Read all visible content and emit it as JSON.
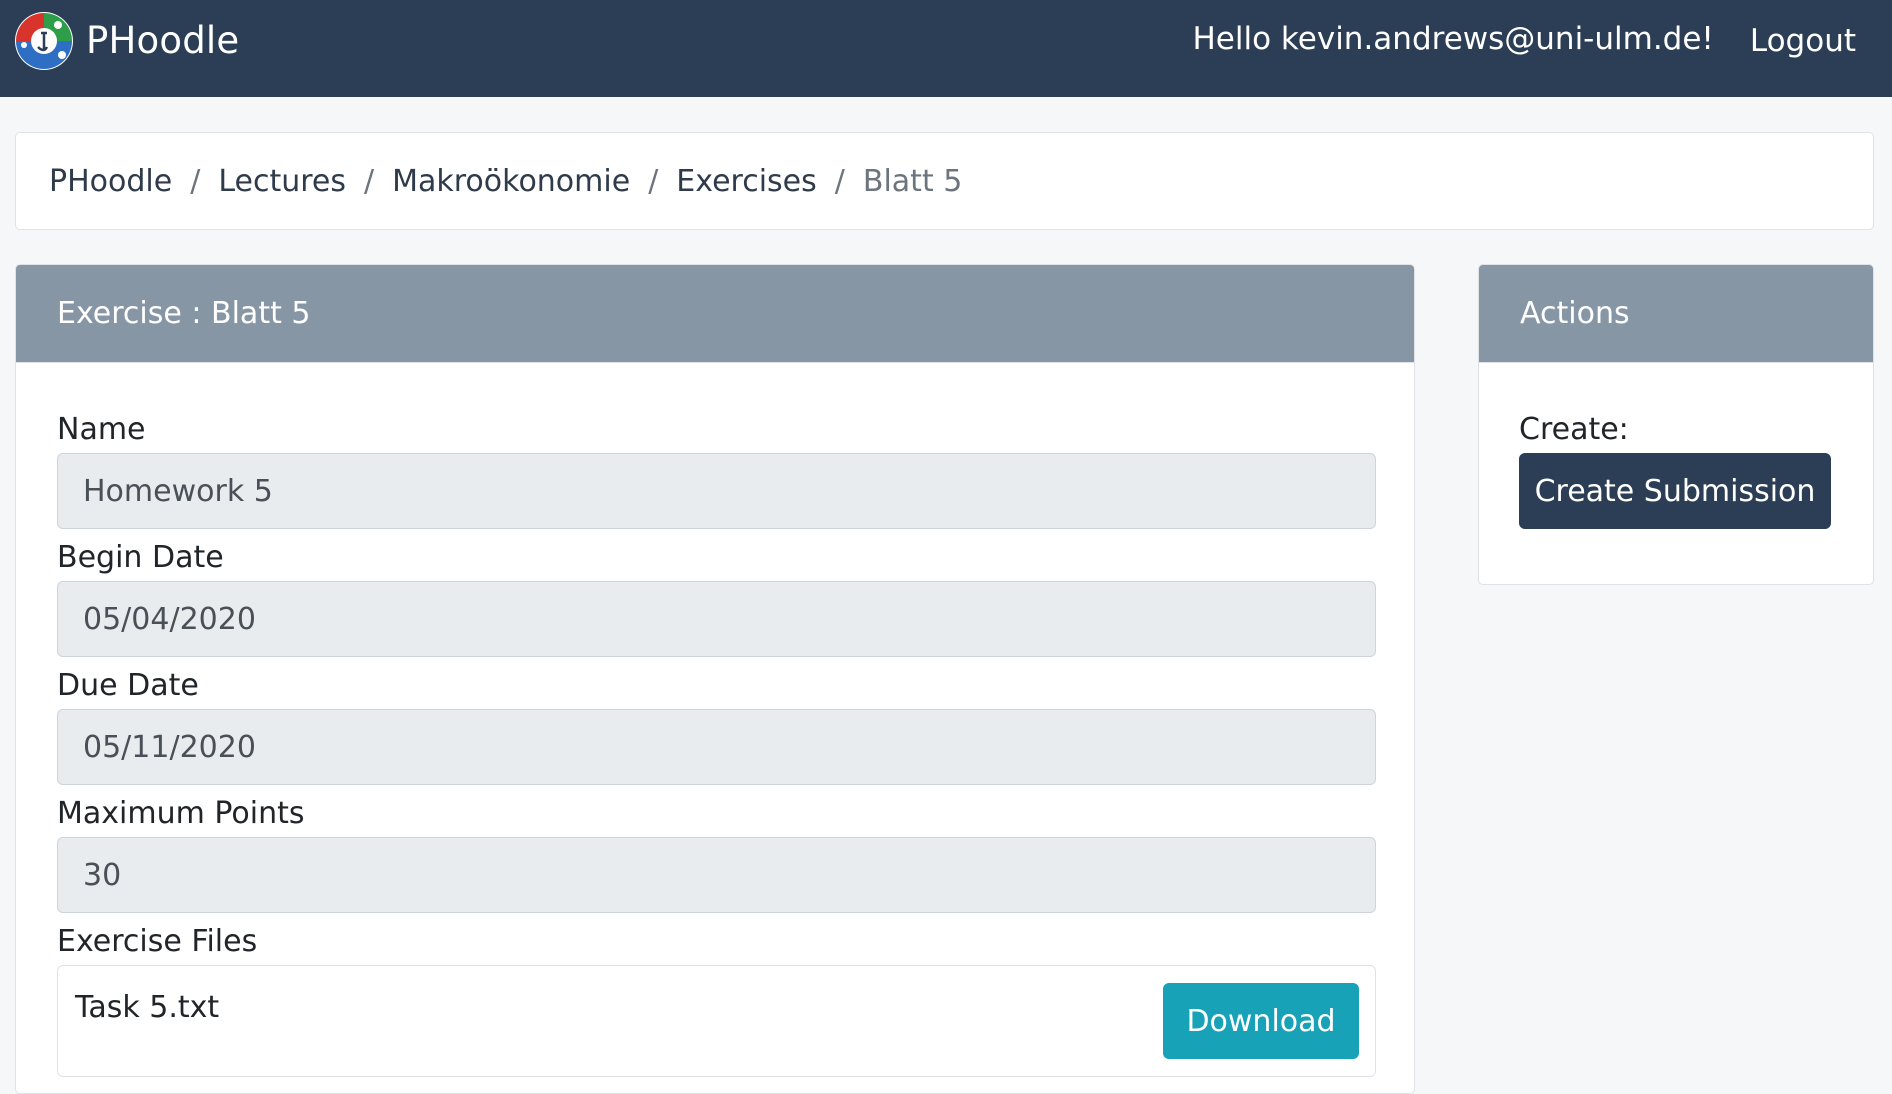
{
  "header": {
    "brand": "PHoodle",
    "greeting": "Hello kevin.andrews@uni-ulm.de!",
    "logout_label": "Logout"
  },
  "breadcrumb": {
    "items": [
      "PHoodle",
      "Lectures",
      "Makroökonomie",
      "Exercises",
      "Blatt 5"
    ],
    "separator": "/"
  },
  "exercise": {
    "header": "Exercise : Blatt 5",
    "name_label": "Name",
    "name_value": "Homework 5",
    "begin_label": "Begin Date",
    "begin_value": "05/04/2020",
    "due_label": "Due Date",
    "due_value": "05/11/2020",
    "points_label": "Maximum Points",
    "points_value": "30",
    "files_label": "Exercise Files",
    "file_name": "Task 5.txt",
    "download_label": "Download"
  },
  "actions": {
    "header": "Actions",
    "create_label": "Create:",
    "create_button": "Create Submission"
  },
  "colors": {
    "navbar": "#2c3e55",
    "card_header": "#8796a5",
    "download_button": "#17a2b8",
    "primary_button": "#2c3e55"
  },
  "icons": {
    "logo": "phoodle-logo-icon"
  }
}
